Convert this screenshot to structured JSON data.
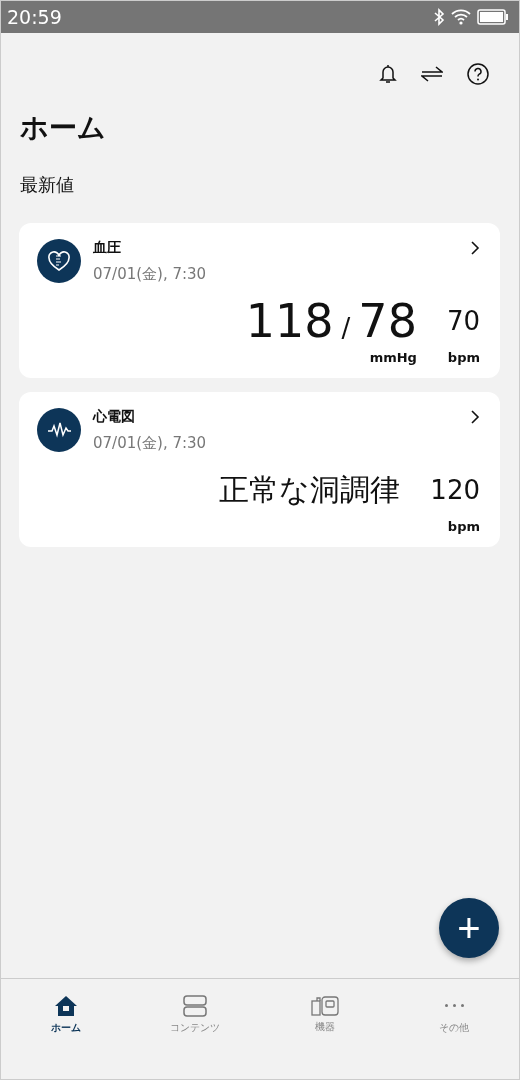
{
  "status_bar": {
    "time": "20:59"
  },
  "title": "ホーム",
  "section": "最新値",
  "cards": [
    {
      "kind": "bp",
      "name": "血圧",
      "date": "07/01(金), 7:30",
      "systolic": "118",
      "separator": "/",
      "diastolic": "78",
      "unit": "mmHg",
      "pulse": "70",
      "pulse_unit": "bpm"
    },
    {
      "kind": "ecg",
      "name": "心電図",
      "date": "07/01(金), 7:30",
      "result": "正常な洞調律",
      "pulse": "120",
      "pulse_unit": "bpm"
    }
  ],
  "fab": {
    "label": "+"
  },
  "nav": [
    {
      "kind": "home",
      "label": "ホーム",
      "selected": true
    },
    {
      "kind": "contents",
      "label": "コンテンツ",
      "selected": false
    },
    {
      "kind": "devices",
      "label": "機器",
      "selected": false
    },
    {
      "kind": "more",
      "label": "その他",
      "selected": false
    }
  ]
}
